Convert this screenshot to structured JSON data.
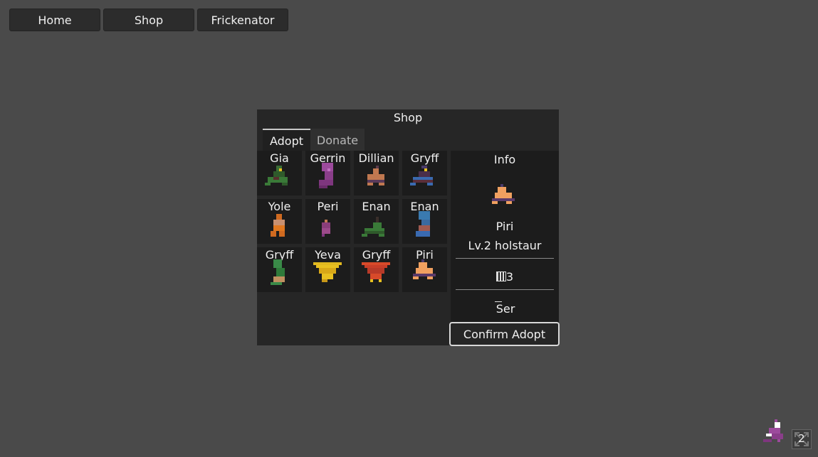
{
  "nav": {
    "home": "Home",
    "shop": "Shop",
    "frickenator": "Frickenator"
  },
  "shop": {
    "title": "Shop",
    "tabs": {
      "adopt": "Adopt",
      "donate": "Donate"
    },
    "active_tab": "Adopt",
    "pets": [
      {
        "name": "Gia"
      },
      {
        "name": "Gerrin"
      },
      {
        "name": "Dillian"
      },
      {
        "name": "Gryff"
      },
      {
        "name": "Yole"
      },
      {
        "name": "Peri"
      },
      {
        "name": "Enan"
      },
      {
        "name": "Enan"
      },
      {
        "name": "Gryff"
      },
      {
        "name": "Yeva"
      },
      {
        "name": "Gryff"
      },
      {
        "name": "Piri"
      }
    ]
  },
  "info": {
    "title": "Info",
    "name": "Piri",
    "level": "Lv.2 holstaur",
    "stat": "3",
    "trait": "Ser",
    "confirm_label": "Confirm Adopt"
  },
  "corner": {
    "count": "2"
  },
  "colors": {
    "background": "#4a4a4a",
    "panel": "#262626",
    "cell": "#1c1c1c",
    "nav_button": "#2c2c2c"
  }
}
